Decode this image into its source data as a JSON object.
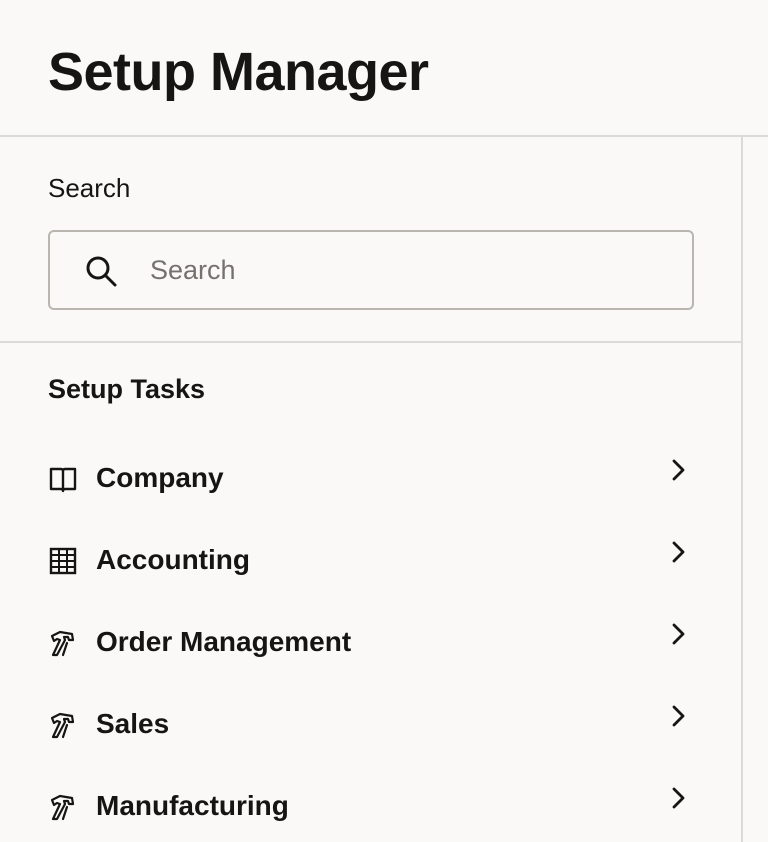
{
  "header": {
    "title": "Setup Manager"
  },
  "search": {
    "label": "Search",
    "placeholder": "Search",
    "value": ""
  },
  "tasks": {
    "heading": "Setup Tasks",
    "items": [
      {
        "label": "Company",
        "icon": "book-icon"
      },
      {
        "label": "Accounting",
        "icon": "grid-icon"
      },
      {
        "label": "Order Management",
        "icon": "hammer-icon"
      },
      {
        "label": "Sales",
        "icon": "hammer-icon"
      },
      {
        "label": "Manufacturing",
        "icon": "hammer-icon"
      }
    ]
  },
  "colors": {
    "background": "#faf9f7",
    "text": "#161513",
    "divider": "#dcdad6",
    "placeholder": "#75726d"
  }
}
